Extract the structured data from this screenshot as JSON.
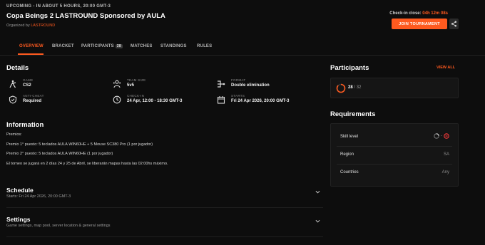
{
  "header": {
    "status": "UPCOMING - IN ABOUT 5 HOURS, 20:00 GMT-3",
    "title": "Copa Beings 2 LASTROUND Sponsored by AULA",
    "organized_by": "Organized by",
    "organizer": "LASTROUND",
    "checkin_label": "Check-in close:",
    "checkin_countdown": "04h 12m 08s",
    "join_label": "JOIN TOURNAMENT",
    "accent_color": "#ff5a1f"
  },
  "tabs": [
    {
      "label": "OVERVIEW"
    },
    {
      "label": "BRACKET"
    },
    {
      "label": "PARTICIPANTS",
      "badge": "28"
    },
    {
      "label": "MATCHES"
    },
    {
      "label": "STANDINGS"
    },
    {
      "label": "RULES"
    }
  ],
  "details": {
    "title": "Details",
    "items": [
      {
        "label": "GAME",
        "value": "CS2",
        "icon": "crosshair-player-icon"
      },
      {
        "label": "TEAM SIZE",
        "value": "5v5",
        "icon": "team-icon"
      },
      {
        "label": "FORMAT",
        "value": "Double elimination",
        "icon": "bracket-format-icon"
      },
      {
        "label": "ANTI-CHEAT",
        "value": "Required",
        "icon": "shield-icon"
      },
      {
        "label": "CHECK-IN",
        "value": "24 Apr, 12:00 - 18:30 GMT-3",
        "icon": "clock-icon"
      },
      {
        "label": "STARTS",
        "value": "Fri 24 Apr 2026, 20:00 GMT-3",
        "icon": "calendar-icon"
      }
    ]
  },
  "information": {
    "title": "Information",
    "lines": [
      "Premios:",
      "Premio 1° puesto: 5 teclados AULA WIN60HE + 5 Mouse SC380 Pro (1 por jugador)",
      "Premio 2° puesto: 5 teclados AULA WIN60HE (1 por jugador)",
      "El torneo se jugará en 2 días 24 y 25 de Abril, se liberarán mapas hasta las 02:00hs máximo."
    ]
  },
  "schedule": {
    "title": "Schedule",
    "subtitle": "Starts: Fri 24 Apr 2026, 20:00 GMT-3"
  },
  "settings": {
    "title": "Settings",
    "subtitle": "Game settings, map pool, server location & general settings"
  },
  "participants": {
    "title": "Participants",
    "view_all": "VIEW ALL",
    "count": "28",
    "total": "/ 32",
    "fill_fraction": 0.875
  },
  "requirements": {
    "title": "Requirements",
    "rows": [
      {
        "key": "Skill level",
        "value": ""
      },
      {
        "key": "Region",
        "value": "SA"
      },
      {
        "key": "Countries",
        "value": "Any"
      }
    ]
  }
}
